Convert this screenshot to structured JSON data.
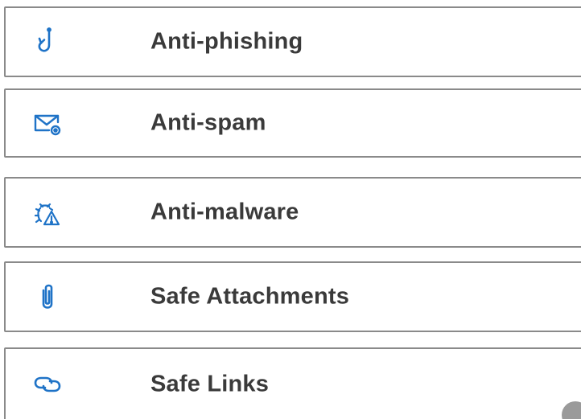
{
  "accent_color": "#1f73c7",
  "policies": [
    {
      "label": "Anti-phishing",
      "icon": "fishhook-icon"
    },
    {
      "label": "Anti-spam",
      "icon": "mail-settings-icon"
    },
    {
      "label": "Anti-malware",
      "icon": "bug-warning-icon"
    },
    {
      "label": "Safe Attachments",
      "icon": "paperclip-icon"
    },
    {
      "label": "Safe Links",
      "icon": "link-icon"
    }
  ]
}
